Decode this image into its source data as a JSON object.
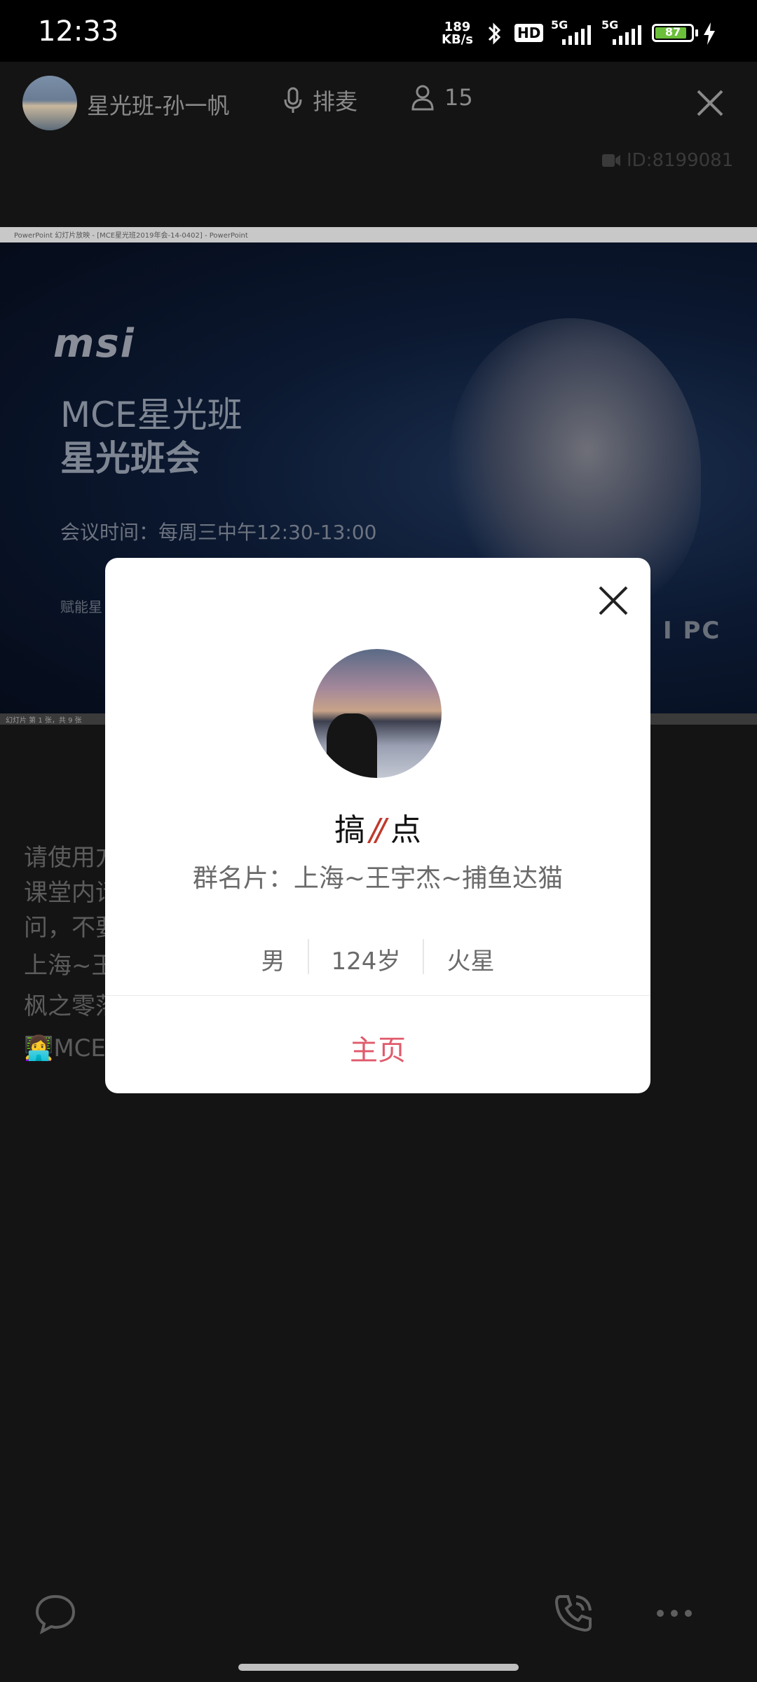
{
  "status_bar": {
    "time": "12:33",
    "net_speed_value": "189",
    "net_speed_unit": "KB/s",
    "hd_label": "HD",
    "signal1_label": "5G",
    "signal2_label": "5G",
    "battery_level": "87",
    "battery_fraction": 0.87,
    "battery_color": "#6bbf3a"
  },
  "header": {
    "room_name": "星光班-孙一帆",
    "mic_label": "排麦",
    "member_count": "15",
    "room_id": "ID:8199081"
  },
  "presentation": {
    "window_title": "PowerPoint 幻灯片放映 - [MCE星光班2019年会-14-0402] - PowerPoint",
    "logo_text": "msi",
    "title_line1": "MCE星光班",
    "title_line2": "星光班会",
    "meeting_time": "会议时间：每周三中午12:30-13:00",
    "subtitle_partial": "赋能星",
    "corner_text": "I PC",
    "status_text": "幻灯片 第 1 张，共 9 张"
  },
  "chat": {
    "lines": [
      "请使用方",
      "课堂内请",
      "问，不要",
      "上海~王",
      "枫之零落",
      "👩‍💻MCE星"
    ]
  },
  "profile_modal": {
    "nickname": "搞",
    "nickname_end": "点",
    "nickname_slashes": "//",
    "group_card_label": "群名片：",
    "group_card_value": "上海~王宇杰~捕鱼达猫",
    "gender": "男",
    "age": "124岁",
    "location": "火星",
    "home_button": "主页",
    "accent_color": "#e05a6c"
  }
}
